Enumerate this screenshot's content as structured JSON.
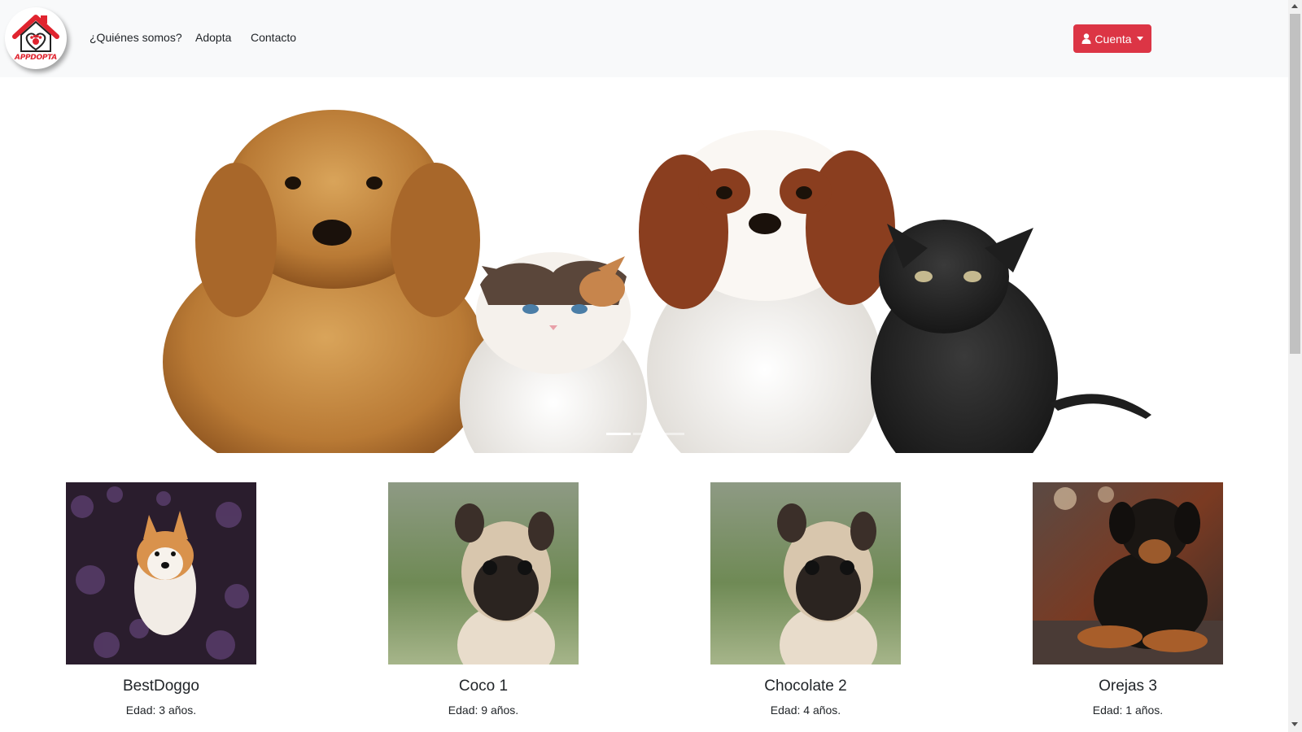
{
  "brand": {
    "logo_text": "APPDOPTA"
  },
  "nav": {
    "items": [
      {
        "label": "¿Quiénes somos?"
      },
      {
        "label": "Adopta"
      },
      {
        "label": "Contacto"
      }
    ],
    "account_label": "Cuenta"
  },
  "carousel": {
    "slide_count": 3,
    "active_index": 0
  },
  "pets": [
    {
      "name": "BestDoggo",
      "age": "Edad: 3 años.",
      "image": "shiba-in-lavender"
    },
    {
      "name": "Coco 1",
      "age": "Edad: 9 años.",
      "image": "pug"
    },
    {
      "name": "Chocolate 2",
      "age": "Edad: 4 años.",
      "image": "pug"
    },
    {
      "name": "Orejas 3",
      "age": "Edad: 1 años.",
      "image": "rottweiler-puppy"
    }
  ],
  "colors": {
    "accent": "#dc3545",
    "navbar_bg": "#f8f9fa"
  }
}
